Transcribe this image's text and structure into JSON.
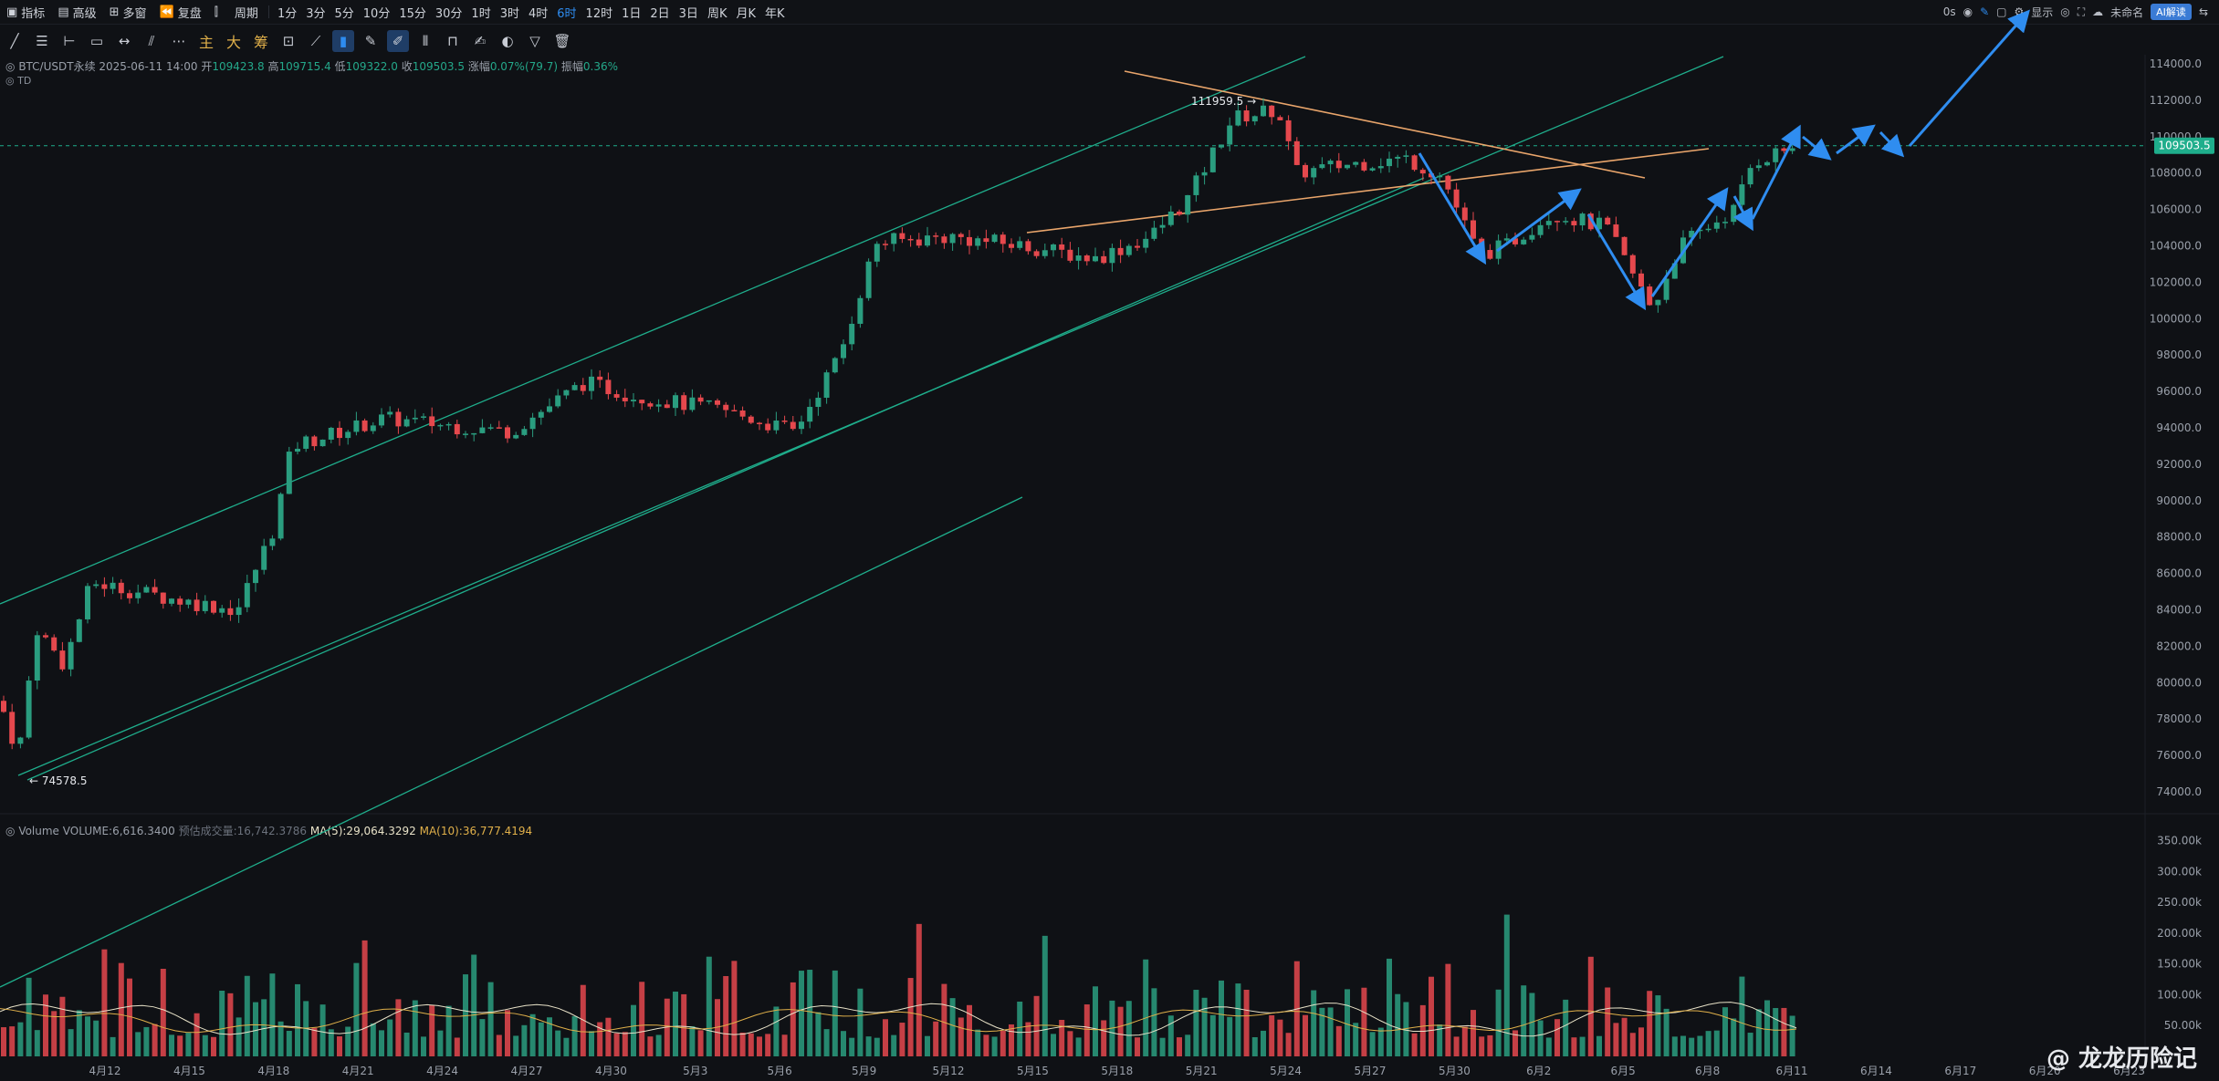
{
  "topbar": {
    "left_items": [
      {
        "icon": "indicator-icon",
        "label": "指标"
      },
      {
        "icon": "calendar-icon",
        "label": "高级"
      },
      {
        "icon": "grid-icon",
        "label": "多窗"
      },
      {
        "icon": "rewind-icon",
        "label": "复盘"
      },
      {
        "icon": "candle-icon",
        "label": ""
      },
      {
        "icon": "",
        "label": "周期"
      }
    ],
    "periods": [
      "1分",
      "3分",
      "5分",
      "10分",
      "15分",
      "30分",
      "1时",
      "3时",
      "4时",
      "6时",
      "12时",
      "1日",
      "2日",
      "3日",
      "周K",
      "月K",
      "年K"
    ],
    "active_period": "6时",
    "right_items": {
      "timer": "0s",
      "display": "显示",
      "unnamed": "未命名",
      "ai": "AI解读"
    }
  },
  "toolbar2": {
    "cn_buttons": [
      "主",
      "大",
      "筹"
    ]
  },
  "info": {
    "symbol": "BTC/USDT永续",
    "datetime": "2025-06-11 14:00",
    "open_label": "开",
    "open": "109423.8",
    "high_label": "高",
    "high": "109715.4",
    "low_label": "低",
    "low": "109322.0",
    "close_label": "收",
    "close": "109503.5",
    "change_label": "涨幅",
    "change": "0.07%(79.7)",
    "amp_label": "振幅",
    "amp": "0.36%",
    "td": "TD"
  },
  "volume_info": {
    "label": "Volume",
    "volume": "VOLUME:6,616.3400",
    "est": "预估成交量:16,742.3786",
    "ma5": "MA(5):29,064.3292",
    "ma10": "MA(10):36,777.4194"
  },
  "annotations": {
    "high": "111959.5",
    "low": "74578.5",
    "last_price": "109503.5"
  },
  "price_axis": [
    "114000.0",
    "112000.0",
    "110000.0",
    "108000.0",
    "106000.0",
    "104000.0",
    "102000.0",
    "100000.0",
    "98000.0",
    "96000.0",
    "94000.0",
    "92000.0",
    "90000.0",
    "88000.0",
    "86000.0",
    "84000.0",
    "82000.0",
    "80000.0",
    "78000.0",
    "76000.0",
    "74000.0"
  ],
  "volume_axis": [
    "350.00k",
    "300.00k",
    "250.00k",
    "200.00k",
    "150.00k",
    "100.00k",
    "50.00k"
  ],
  "date_axis": [
    "4月12",
    "4月15",
    "4月18",
    "4月21",
    "4月24",
    "4月27",
    "4月30",
    "5月3",
    "5月6",
    "5月9",
    "5月12",
    "5月15",
    "5月18",
    "5月21",
    "5月24",
    "5月27",
    "5月30",
    "6月2",
    "6月5",
    "6月8",
    "6月11",
    "6月14",
    "6月17",
    "6月20",
    "6月23"
  ],
  "watermark": "@ 龙龙历险记",
  "colors": {
    "up": "#2a9d7f",
    "down": "#e5484d",
    "channel": "#1fae8c",
    "orange": "#e9a56b",
    "arrow": "#2f8df0",
    "bg": "#0f1115"
  }
}
